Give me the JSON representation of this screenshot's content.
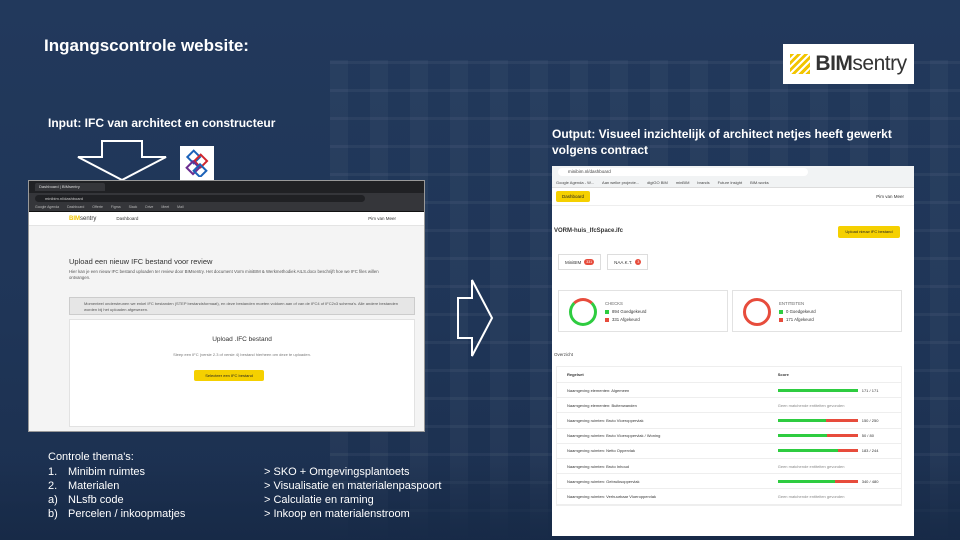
{
  "slide": {
    "title": "Ingangscontrole website:",
    "input_label": "Input: IFC van architect en constructeur",
    "output_label": "Output: Visueel inzichtelijk of architect netjes heeft gewerkt volgens contract",
    "logo": {
      "text_bold": "BIM",
      "text_rest": "sentry"
    }
  },
  "left_screenshot": {
    "tab": "Dashboard | BIMsentry",
    "url": "minibim.nl/dashboard",
    "bookmarks": [
      "Google Agenda",
      "Dashboard",
      "Offerte",
      "Figma",
      "Slack",
      "Drive",
      "Meet",
      "Mail"
    ],
    "app_logo_bold": "BIM",
    "app_logo_rest": "sentry",
    "nav": "Dashboard",
    "user": "Pim van Meer",
    "upload_title": "Upload een nieuw IFC bestand voor review",
    "upload_desc": "Hier kan je een nieuw IFC bestand uploaden ter review door BIMsentry. Het document Vorm miniBIM & Werkmethodiek AILS.docx beschrijft hoe we IFC files willen ontvangen.",
    "warning": "Momenteel ondersteunen we enkel IFC bestanden (STEP bestandsformaat), en deze bestanden moeten voldoen aan of van de IFC4 of IFC2x3 schema's. Alle andere bestanden worden bij het uploaden afgewezen.",
    "card_title": "Upload .IFC bestand",
    "card_hint": "Sleep een IFC (versie 2.3 of versie 4) bestand hierheen om deze te uploaden.",
    "card_button": "Selecteer een IFC bestand"
  },
  "right_screenshot": {
    "url": "minibim.nl/dashboard",
    "bookmarks": [
      "Google Agenda - W...",
      "Aan welke projecte...",
      "digiGO BIM",
      "minBIM",
      "brands",
      "Future Insight",
      "BIM.works"
    ],
    "dashboard_button": "Dashboard",
    "user": "Pim van Meer",
    "project": "VORM-huis_IfcSpace.ifc",
    "upload_new": "Upload nieuw IFC bestand",
    "tabs": [
      {
        "label": "MiniBIM",
        "badge": "331"
      },
      {
        "label": "NAA.K.T.",
        "badge": "3"
      }
    ],
    "checks": {
      "title": "CHECKS",
      "approved": "894 Goedgekeurd",
      "rejected": "331 Afgekeurd"
    },
    "entities": {
      "title": "ENTITEITEN",
      "approved": "0 Goedgekeurd",
      "rejected": "171 Afgekeurd"
    },
    "overview_label": "Overzicht",
    "table": {
      "headers": [
        "Regelset",
        "Score"
      ],
      "rows": [
        {
          "rule": "Naamgeving elementen: Algemeen",
          "score": "171 / 171",
          "ratio": 1.0
        },
        {
          "rule": "Naamgeving elementen: Buitenwanden",
          "score": "Geen matchende entiteiten gevonden",
          "ratio": null
        },
        {
          "rule": "Naamgeving ruimten: Bruto Vloeroppervlak",
          "score": "150 / 250",
          "ratio": 0.6
        },
        {
          "rule": "Naamgeving ruimten: Bruto Vloeroppervlak / Woning",
          "score": "50 / 80",
          "ratio": 0.62
        },
        {
          "rule": "Naamgeving ruimten: Netto Oppervlak",
          "score": "183 / 244",
          "ratio": 0.75
        },
        {
          "rule": "Naamgeving ruimten: Bruto Inhoud",
          "score": "Geen matchende entiteiten gevonden",
          "ratio": null
        },
        {
          "rule": "Naamgeving ruimten: Gebruiksoppervlak",
          "score": "340 / 480",
          "ratio": 0.71
        },
        {
          "rule": "Naamgeving ruimten: Verhuurbaar Vloeroppervlak",
          "score": "Geen matchende entiteiten gevonden",
          "ratio": null
        }
      ]
    }
  },
  "controle": {
    "title": "Controle thema's:",
    "left_items": [
      {
        "n": "1.",
        "text": "Minibim ruimtes"
      },
      {
        "n": "2.",
        "text": "Materialen"
      },
      {
        "n": "a)",
        "text": "NLsfb code"
      },
      {
        "n": "b)",
        "text": "Percelen / inkoopmatjes"
      }
    ],
    "right_items": [
      "> SKO + Omgevingsplantoets",
      "> Visualisatie en materialenpaspoort",
      "> Calculatie en raming",
      "> Inkoop en materialenstroom"
    ]
  },
  "colors": {
    "accent": "#f5d000",
    "ok": "#2ecc40",
    "fail": "#e74c3c",
    "slide_bg": "#233a5e"
  }
}
